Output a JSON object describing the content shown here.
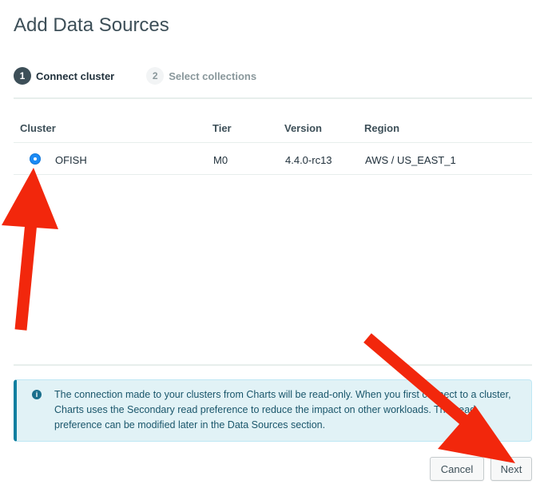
{
  "dialog": {
    "title": "Add Data Sources"
  },
  "steps": [
    {
      "number": "1",
      "label": "Connect cluster",
      "state": "active"
    },
    {
      "number": "2",
      "label": "Select collections",
      "state": "inactive"
    }
  ],
  "table": {
    "columns": [
      "Cluster",
      "Tier",
      "Version",
      "Region"
    ],
    "rows": [
      {
        "selected": true,
        "cluster": "OFISH",
        "tier": "M0",
        "version": "4.4.0-rc13",
        "region": "AWS / US_EAST_1"
      }
    ]
  },
  "info": {
    "icon": "info-icon",
    "text": "The connection made to your clusters from Charts will be read-only. When you first connect to a cluster, Charts uses the Secondary read preference to reduce the impact on other workloads. This read preference can be modified later in the Data Sources section."
  },
  "buttons": {
    "cancel": "Cancel",
    "next": "Next"
  },
  "annotations": {
    "arrow_color": "#f2270c"
  }
}
